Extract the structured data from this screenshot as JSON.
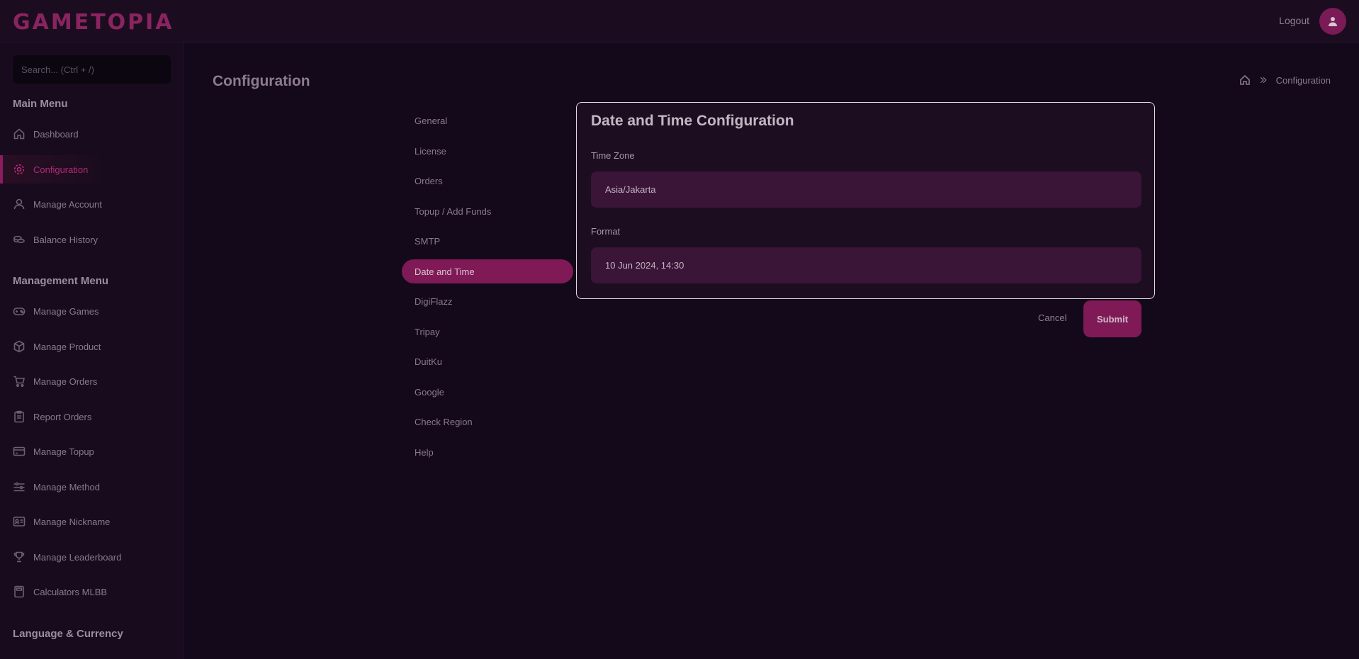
{
  "app": {
    "logo": "GAMETOPIA"
  },
  "header": {
    "logout_label": "Logout"
  },
  "sidebar": {
    "search_placeholder": "Search... (Ctrl + /)",
    "main_menu_title": "Main Menu",
    "main_items": [
      {
        "label": "Dashboard",
        "icon": "home-icon"
      },
      {
        "label": "Configuration",
        "icon": "gear-icon",
        "active": true
      },
      {
        "label": "Manage Account",
        "icon": "user-icon"
      },
      {
        "label": "Balance History",
        "icon": "coins-icon"
      }
    ],
    "management_menu_title": "Management Menu",
    "management_items": [
      {
        "label": "Manage Games",
        "icon": "gamepad-icon"
      },
      {
        "label": "Manage Product",
        "icon": "box-icon"
      },
      {
        "label": "Manage Orders",
        "icon": "cart-icon"
      },
      {
        "label": "Report Orders",
        "icon": "clipboard-icon"
      },
      {
        "label": "Manage Topup",
        "icon": "card-icon"
      },
      {
        "label": "Manage Method",
        "icon": "sliders-icon"
      },
      {
        "label": "Manage Nickname",
        "icon": "id-card-icon"
      },
      {
        "label": "Manage Leaderboard",
        "icon": "trophy-icon"
      },
      {
        "label": "Calculators MLBB",
        "icon": "calculator-icon"
      }
    ],
    "language_title": "Language & Currency"
  },
  "page": {
    "title": "Configuration",
    "breadcrumb_current": "Configuration"
  },
  "config_menu": [
    {
      "label": "General"
    },
    {
      "label": "License"
    },
    {
      "label": "Orders"
    },
    {
      "label": "Topup / Add Funds"
    },
    {
      "label": "SMTP"
    },
    {
      "label": "Date and Time",
      "active": true
    },
    {
      "label": "DigiFlazz"
    },
    {
      "label": "Tripay"
    },
    {
      "label": "DuitKu"
    },
    {
      "label": "Google"
    },
    {
      "label": "Check Region"
    },
    {
      "label": "Help"
    }
  ],
  "form": {
    "title": "Date and Time Configuration",
    "timezone_label": "Time Zone",
    "timezone_value": "Asia/Jakarta",
    "format_label": "Format",
    "format_value": "10 Jun 2024, 14:30",
    "cancel_label": "Cancel",
    "submit_label": "Submit"
  }
}
